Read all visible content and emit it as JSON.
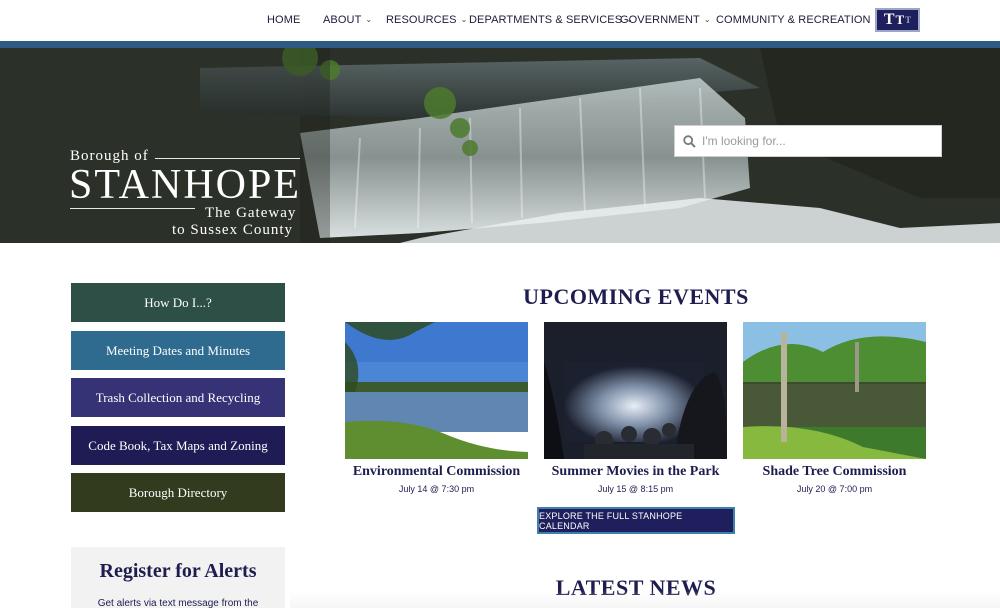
{
  "nav": {
    "items": [
      {
        "label": "HOME",
        "has_dropdown": false
      },
      {
        "label": "ABOUT",
        "has_dropdown": true
      },
      {
        "label": "RESOURCES",
        "has_dropdown": true
      },
      {
        "label": "DEPARTMENTS & SERVICES",
        "has_dropdown": true
      },
      {
        "label": "GOVERNMENT",
        "has_dropdown": true
      },
      {
        "label": "COMMUNITY & RECREATION",
        "has_dropdown": true
      }
    ],
    "chevron": "⌄",
    "logo": {
      "letters": [
        "T",
        "T",
        "T"
      ],
      "icon": "site-logo-icon"
    },
    "stripe_color": "#2d5a85"
  },
  "hero": {
    "borough_of": "Borough of",
    "town_name": "STANHOPE",
    "tagline_1": "The Gateway",
    "tagline_2": "to Sussex County",
    "search": {
      "placeholder": "I'm looking for...",
      "icon": "search-icon"
    }
  },
  "quick_links": [
    {
      "label": "How Do I...?",
      "color": "#2e4f45"
    },
    {
      "label": "Meeting Dates and Minutes",
      "color": "#2e6b8f"
    },
    {
      "label": "Trash Collection and Recycling",
      "color": "#353275"
    },
    {
      "label": "Code Book, Tax Maps and Zoning",
      "color": "#1e1b55"
    },
    {
      "label": "Borough Directory",
      "color": "#323b1e"
    }
  ],
  "alerts": {
    "title": "Register for Alerts",
    "text": "Get alerts via text message from the"
  },
  "events": {
    "heading": "UPCOMING EVENTS",
    "items": [
      {
        "title": "Environmental Commission",
        "date": "July 14 @ 7:30 pm"
      },
      {
        "title": "Summer Movies in the Park",
        "date": "July 15 @ 8:15 pm"
      },
      {
        "title": "Shade Tree Commission",
        "date": "July 20 @ 7:00 pm"
      }
    ],
    "calendar_button": "EXPLORE THE FULL STANHOPE CALENDAR"
  },
  "news": {
    "heading": "LATEST NEWS"
  },
  "colors": {
    "navy": "#1e1f5c",
    "heading_text": "#1d1d4f",
    "accent_blue": "#3e7fae"
  }
}
